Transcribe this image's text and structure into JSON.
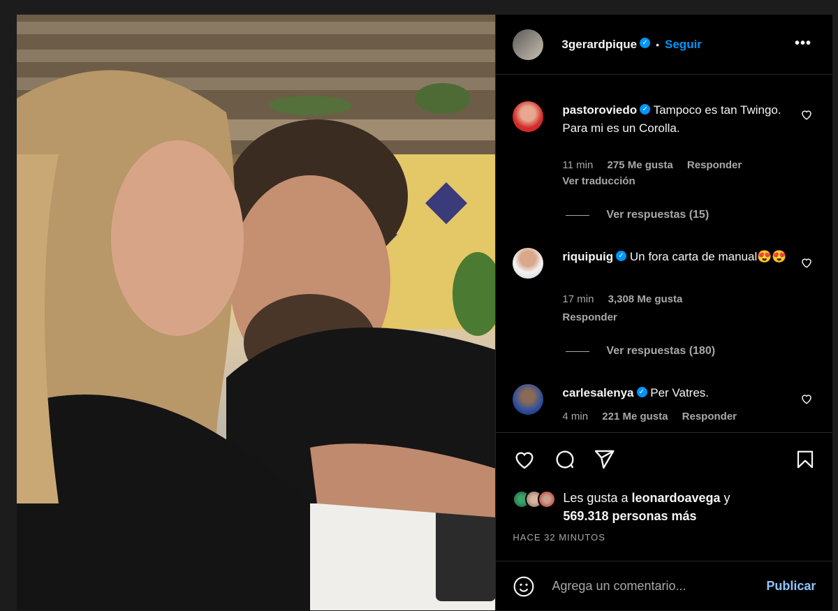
{
  "post": {
    "author": "3gerardpique",
    "follow_label": "Seguir",
    "separator": "•",
    "more_label": "•••"
  },
  "comments": [
    {
      "user": "pastoroviedo",
      "text": "Tampoco es tan Twingo. Para mi es un Corolla.",
      "time": "11 min",
      "likes": "275 Me gusta",
      "reply_label": "Responder",
      "translate_label": "Ver traducción",
      "view_replies": "Ver respuestas (15)"
    },
    {
      "user": "riquipuig",
      "text": "Un fora carta de manual😍😍",
      "time": "17 min",
      "likes": "3,308 Me gusta",
      "reply_label": "Responder",
      "view_replies": "Ver respuestas (180)"
    },
    {
      "user": "carlesalenya",
      "text": "Per Vatres.",
      "time": "4 min",
      "likes": "221 Me gusta",
      "reply_label": "Responder"
    }
  ],
  "likes": {
    "prefix": "Les gusta a ",
    "user": "leonardoavega",
    "connector": " y",
    "count": "569.318 personas más"
  },
  "time_ago": "HACE 32 MINUTOS",
  "composer": {
    "placeholder": "Agrega un comentario...",
    "publish_label": "Publicar"
  },
  "colors": {
    "accent": "#0095f6",
    "background": "#000000",
    "muted": "#a8a8a8"
  }
}
